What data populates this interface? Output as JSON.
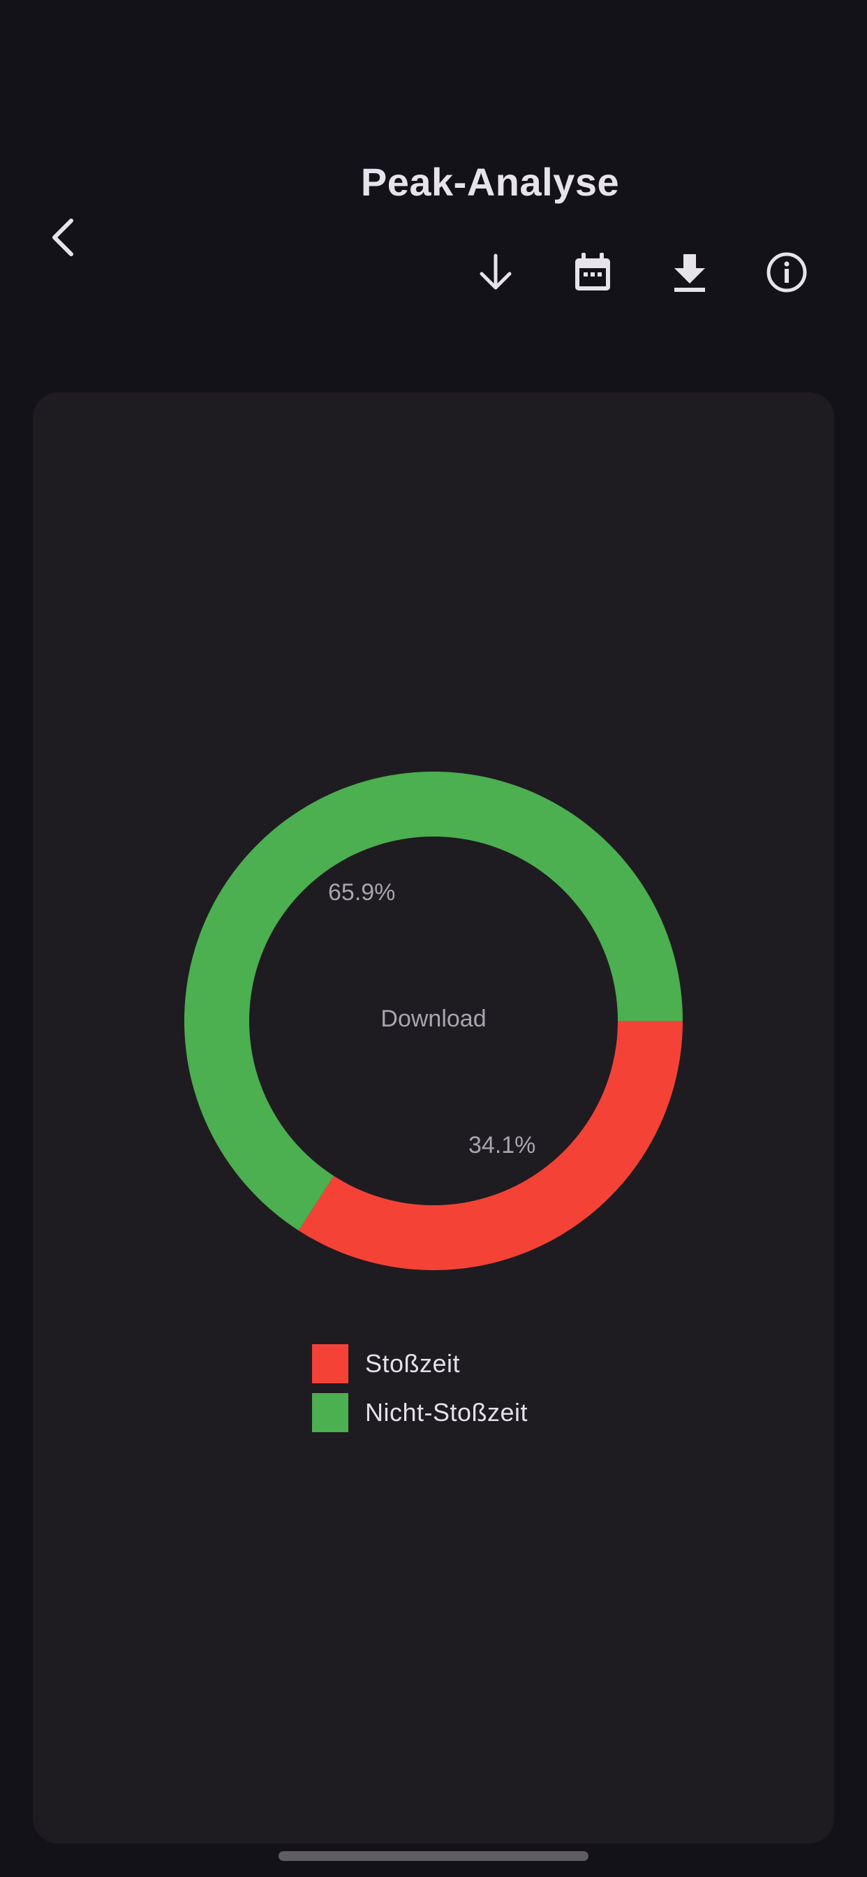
{
  "header": {
    "title": "Peak-Analyse",
    "back_icon": "chevron-left-icon",
    "actions": [
      {
        "icon": "arrow-down-icon"
      },
      {
        "icon": "calendar-icon"
      },
      {
        "icon": "download-icon"
      },
      {
        "icon": "info-icon"
      }
    ]
  },
  "chart_data": {
    "type": "pie",
    "center_label": "Download",
    "series": [
      {
        "name": "Stoßzeit",
        "value": 34.1,
        "label": "34.1%",
        "color": "#f44336"
      },
      {
        "name": "Nicht-Stoßzeit",
        "value": 65.9,
        "label": "65.9%",
        "color": "#4caf50"
      }
    ],
    "legend_position": "bottom"
  },
  "colors": {
    "background": "#141219",
    "card": "#1e1c21",
    "peak": "#f44336",
    "off_peak": "#4caf50"
  }
}
